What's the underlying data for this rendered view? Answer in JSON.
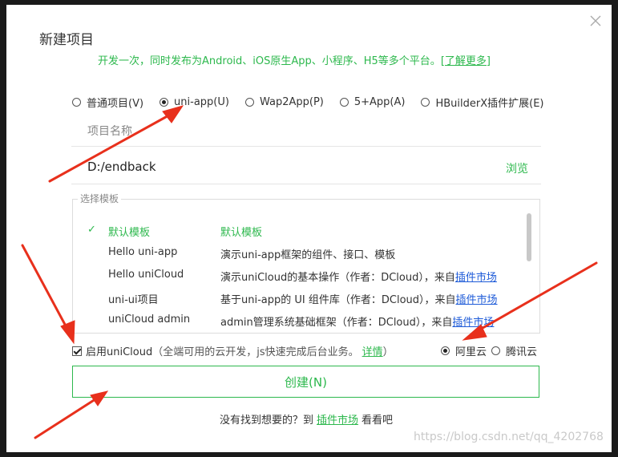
{
  "dialog": {
    "title": "新建项目",
    "subtitle": "开发一次，同时发布为Android、iOS原生App、小程序、H5等多个平台。",
    "learn_more": "[了解更多]"
  },
  "project_types": [
    {
      "label": "普通项目(V)",
      "selected": false
    },
    {
      "label": "uni-app(U)",
      "selected": true
    },
    {
      "label": "Wap2App(P)",
      "selected": false
    },
    {
      "label": "5+App(A)",
      "selected": false
    },
    {
      "label": "HBuilderX插件扩展(E)",
      "selected": false
    }
  ],
  "project_name": {
    "placeholder": "项目名称"
  },
  "project_path": {
    "value": "D:/endback",
    "browse_label": "浏览"
  },
  "templates": {
    "legend": "选择模板",
    "check_mark": "✓",
    "rows": [
      {
        "name": "默认模板",
        "desc": "默认模板",
        "from": "",
        "link": ""
      },
      {
        "name": "Hello uni-app",
        "desc": "演示uni-app框架的组件、接口、模板",
        "from": "",
        "link": ""
      },
      {
        "name": "Hello uniCloud",
        "desc": "演示uniCloud的基本操作（作者：DCloud）",
        "from": "，来自",
        "link": "插件市场"
      },
      {
        "name": "uni-ui项目",
        "desc": "基于uni-app的 UI 组件库（作者：DCloud）",
        "from": "，来自",
        "link": "插件市场"
      },
      {
        "name": "uniCloud admin",
        "desc": "admin管理系统基础框架（作者：DCloud）",
        "from": "，来自",
        "link": "插件市场"
      }
    ]
  },
  "unicloud": {
    "checkbox_label": "启用uniCloud",
    "hint": "（全端可用的云开发，js快速完成后台业务。",
    "details_link": "详情",
    "hint_close": "）",
    "providers": [
      {
        "label": "阿里云",
        "selected": true
      },
      {
        "label": "腾讯云",
        "selected": false
      }
    ]
  },
  "create_button": "创建(N)",
  "footer": {
    "prefix": "没有找到想要的？到",
    "link": "插件市场",
    "suffix": "看看吧"
  },
  "watermark": "https://blog.csdn.net/qq_4202768"
}
